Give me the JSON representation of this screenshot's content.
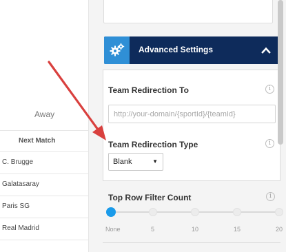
{
  "table": {
    "away_header": "Away",
    "next_match_header": "Next Match",
    "rows": [
      "C. Brugge",
      "Galatasaray",
      "Paris SG",
      "Real Madrid"
    ]
  },
  "advanced": {
    "title": "Advanced Settings",
    "gear_icon": "gears-icon",
    "chevron_icon": "chevron-up-icon",
    "header_color": "#0e2b5b",
    "icon_bg_color": "#2f8fd6"
  },
  "redirection_to": {
    "label": "Team Redirection To",
    "placeholder": "http://your-domain/{sportId}/{teamId}"
  },
  "redirection_type": {
    "label": "Team Redirection Type",
    "selected": "Blank"
  },
  "top_row_filter": {
    "label": "Top Row Filter Count",
    "ticks": [
      "None",
      "5",
      "10",
      "15",
      "20"
    ],
    "selected": "None",
    "handle_color": "#1a9bea"
  },
  "info_glyph": "i",
  "annotation": {
    "arrow_color": "#d9403e"
  }
}
